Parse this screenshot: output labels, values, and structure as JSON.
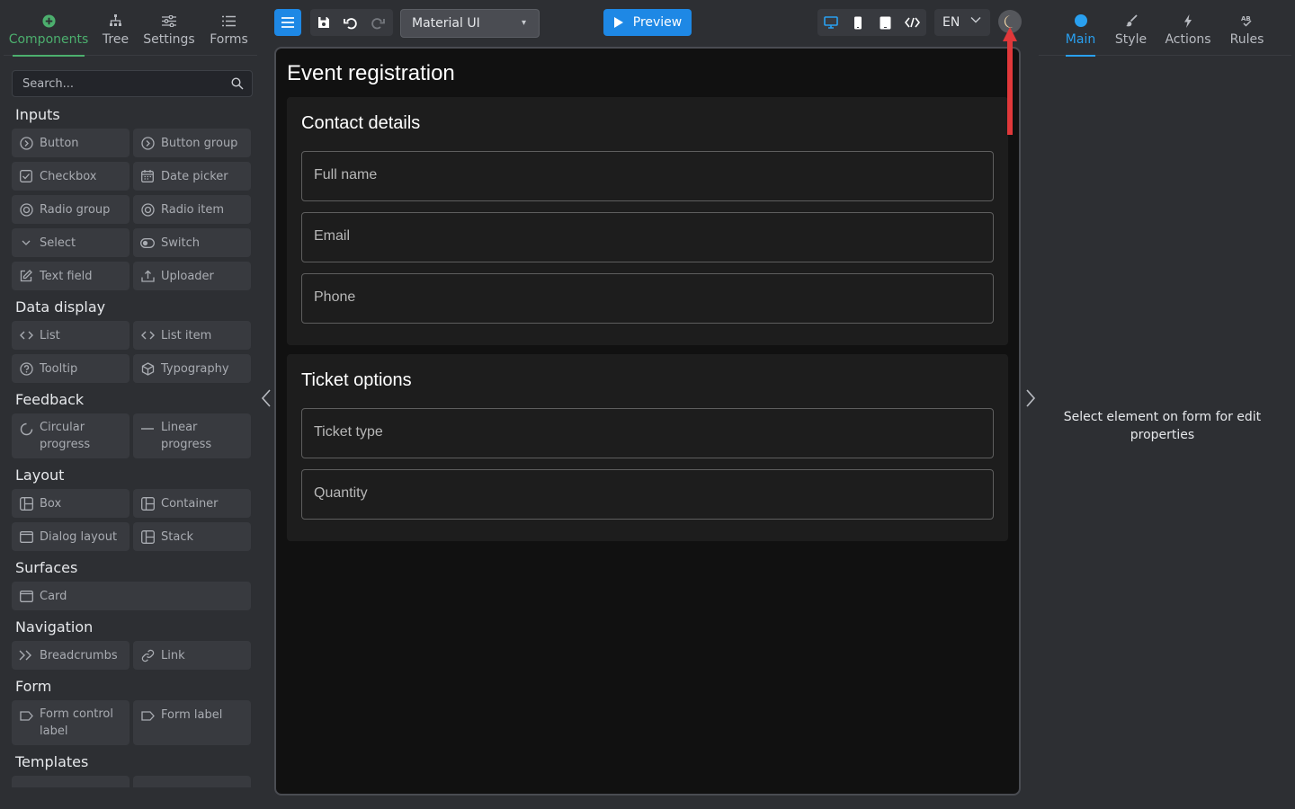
{
  "left_tabs": [
    {
      "label": "Components",
      "icon": "plus-circle-icon",
      "active": true
    },
    {
      "label": "Tree",
      "icon": "tree-icon"
    },
    {
      "label": "Settings",
      "icon": "sliders-icon"
    },
    {
      "label": "Forms",
      "icon": "list-icon"
    }
  ],
  "search": {
    "placeholder": "Search..."
  },
  "palette": {
    "inputs": {
      "title": "Inputs",
      "items": [
        "Button",
        "Button group",
        "Checkbox",
        "Date picker",
        "Radio group",
        "Radio item",
        "Select",
        "Switch",
        "Text field",
        "Uploader"
      ]
    },
    "data_display": {
      "title": "Data display",
      "items": [
        "List",
        "List item",
        "Tooltip",
        "Typography"
      ]
    },
    "feedback": {
      "title": "Feedback",
      "items": [
        "Circular progress",
        "Linear progress"
      ]
    },
    "layout": {
      "title": "Layout",
      "items": [
        "Box",
        "Container",
        "Dialog layout",
        "Stack"
      ]
    },
    "surfaces": {
      "title": "Surfaces",
      "items": [
        "Card"
      ]
    },
    "navigation": {
      "title": "Navigation",
      "items": [
        "Breadcrumbs",
        "Link"
      ]
    },
    "form": {
      "title": "Form",
      "items": [
        "Form control label",
        "Form label"
      ]
    },
    "templates": {
      "title": "Templates"
    }
  },
  "toolbar": {
    "theme_select": "Material UI",
    "preview_label": "Preview",
    "language": "EN"
  },
  "canvas": {
    "form_title": "Event registration",
    "sections": [
      {
        "title": "Contact details",
        "fields": [
          "Full name",
          "Email",
          "Phone"
        ]
      },
      {
        "title": "Ticket options",
        "fields": [
          "Ticket type",
          "Quantity"
        ]
      }
    ]
  },
  "right_tabs": [
    {
      "label": "Main",
      "icon": "circle-icon",
      "active": true
    },
    {
      "label": "Style",
      "icon": "brush-icon"
    },
    {
      "label": "Actions",
      "icon": "lightning-icon"
    },
    {
      "label": "Rules",
      "icon": "rules-icon"
    }
  ],
  "right_panel": {
    "hint": "Select element on form for edit properties"
  },
  "colors": {
    "accent_green": "#4caf6e",
    "accent_blue": "#1e88e5",
    "tab_blue": "#29a0f0",
    "annotation_red": "#e0383a"
  }
}
